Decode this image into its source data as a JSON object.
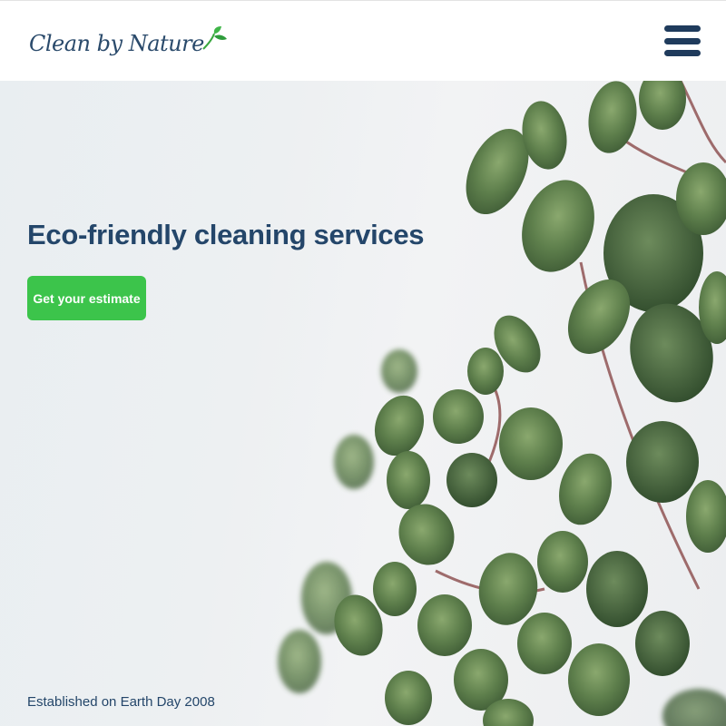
{
  "header": {
    "logo_text": "Clean by Nature",
    "logo_icon": "leaf-sprout-icon",
    "menu_icon": "hamburger-menu-icon"
  },
  "hero": {
    "title": "Eco-friendly cleaning services",
    "cta_label": "Get your estimate",
    "established": "Established on Earth Day 2008"
  },
  "colors": {
    "brand_navy": "#24466a",
    "brand_green": "#3cc44b",
    "menu_icon": "#1f3b5c"
  }
}
